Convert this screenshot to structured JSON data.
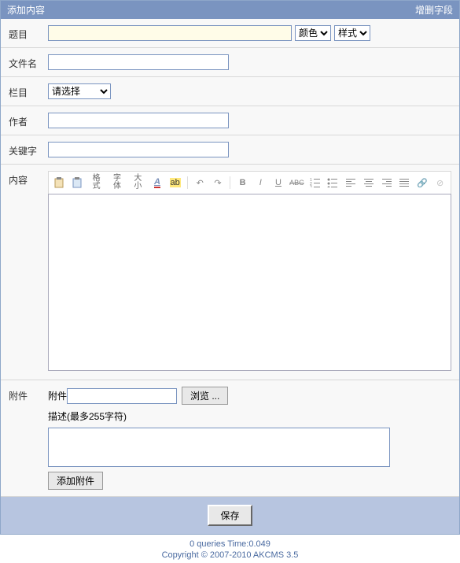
{
  "header": {
    "title": "添加内容",
    "right": "增删字段"
  },
  "labels": {
    "title": "题目",
    "filename": "文件名",
    "category": "栏目",
    "author": "作者",
    "keywords": "关键字",
    "content": "内容",
    "attachment": "附件"
  },
  "title_row": {
    "color_label": "颜色",
    "style_label": "样式"
  },
  "category_placeholder": "请选择",
  "toolbar": {
    "format": "格式",
    "font": "字体",
    "size": "大小",
    "bold": "B",
    "italic": "I",
    "underline": "U",
    "strike": "ABC"
  },
  "attachment": {
    "label": "附件",
    "browse": "浏览 ...",
    "desc_label": "描述(最多255字符)",
    "add": "添加附件"
  },
  "footer": {
    "save": "保存"
  },
  "stats": "0 queries Time:0.049",
  "copyright": "Copyright © 2007-2010 AKCMS 3.5"
}
